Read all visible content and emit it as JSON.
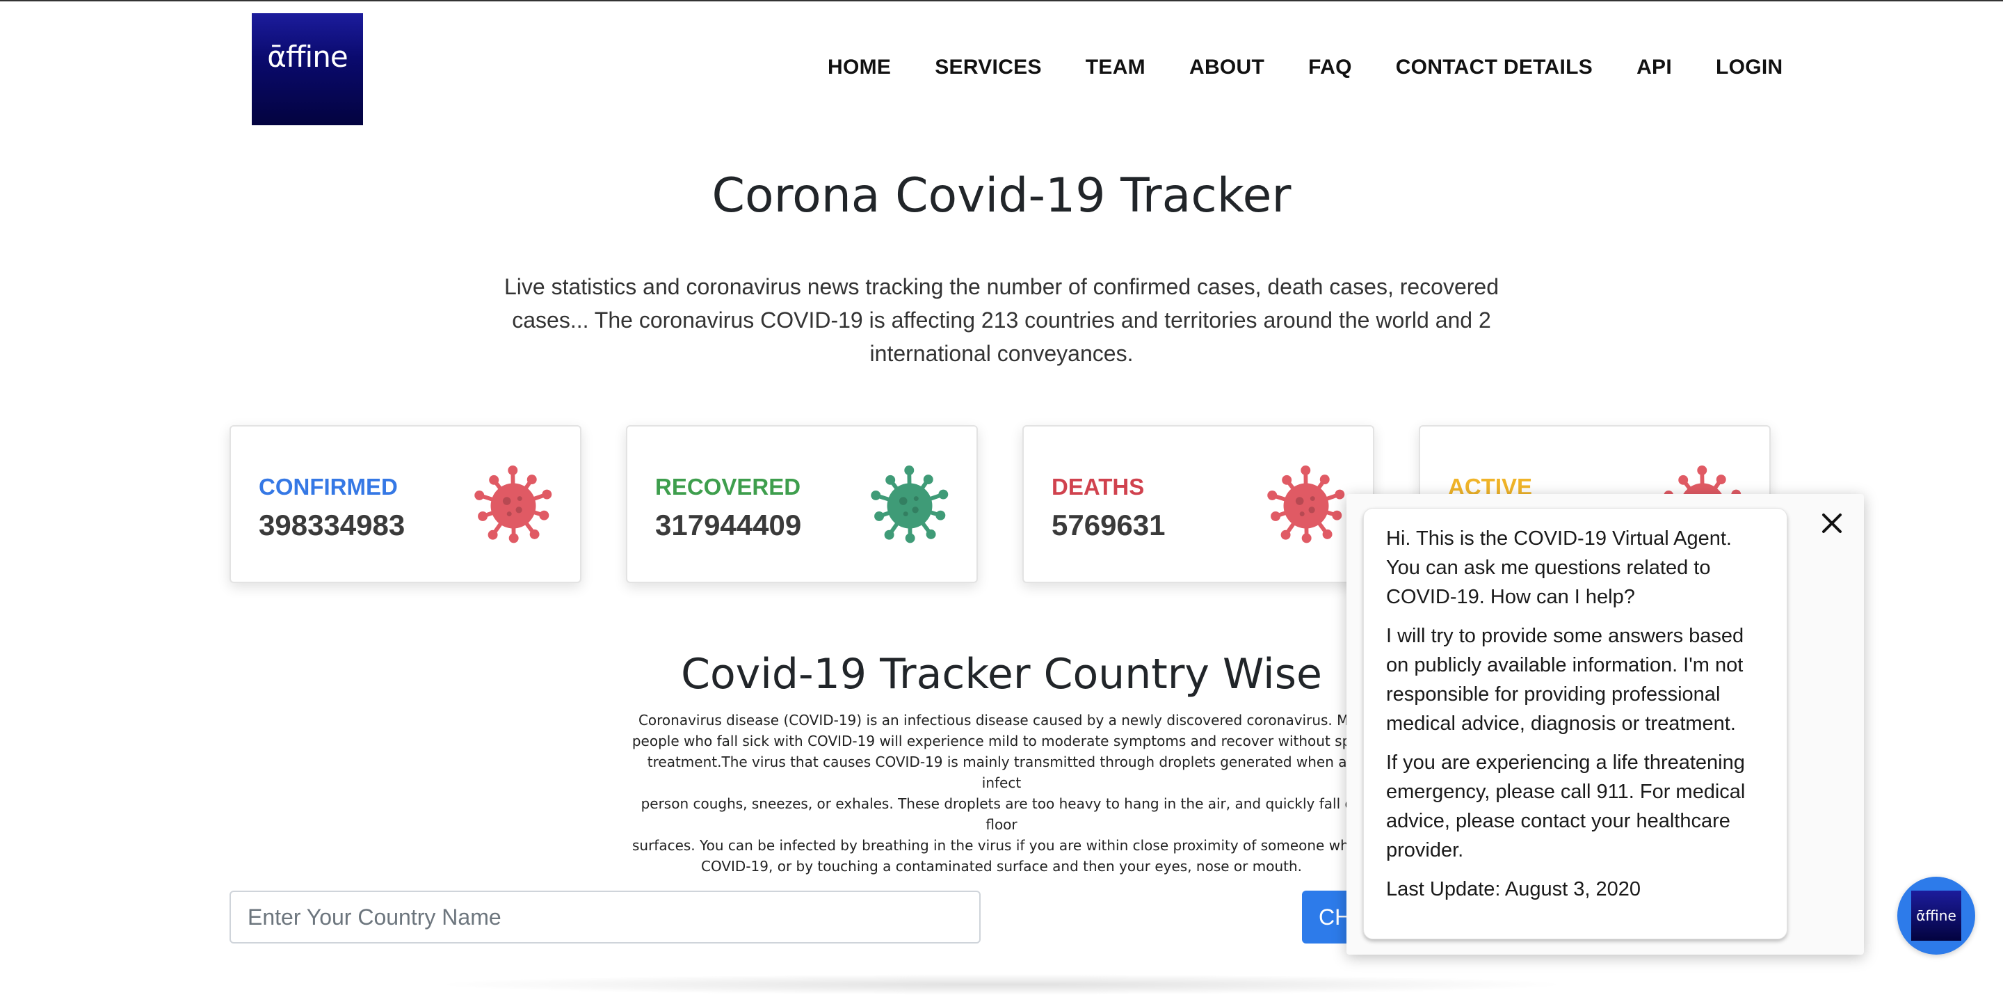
{
  "brand": {
    "logo_text": "ᾱffine"
  },
  "nav": {
    "items": [
      "HOME",
      "SERVICES",
      "TEAM",
      "ABOUT",
      "FAQ",
      "CONTACT DETAILS",
      "API",
      "LOGIN"
    ]
  },
  "hero": {
    "title": "Corona Covid-19 Tracker",
    "description": "Live statistics and coronavirus news tracking the number of confirmed cases, death cases, recovered cases... The coronavirus COVID-19 is affecting 213 countries and territories around the world and 2 international conveyances."
  },
  "stats": [
    {
      "label": "CONFIRMED",
      "value": "398334983",
      "label_color": "#3578e5",
      "icon": "virus-icon",
      "icon_color": "#e05a64"
    },
    {
      "label": "RECOVERED",
      "value": "317944409",
      "label_color": "#3e9e4d",
      "icon": "virus-icon",
      "icon_color": "#3f9b77"
    },
    {
      "label": "DEATHS",
      "value": "5769631",
      "label_color": "#d0424e",
      "icon": "virus-icon",
      "icon_color": "#e05a64"
    },
    {
      "label": "ACTIVE",
      "value": "",
      "label_color": "#f0b429",
      "icon": "virus-icon",
      "icon_color": "#e05a64"
    }
  ],
  "country_section": {
    "title": "Covid-19 Tracker Country Wise",
    "description_lines": [
      "Coronavirus disease (COVID-19) is an infectious disease caused by a newly discovered coronavirus. Mos",
      "people who fall sick with COVID-19 will experience mild to moderate symptoms and recover without speci",
      "treatment.The virus that causes COVID-19 is mainly transmitted through droplets generated when an infect",
      "person coughs, sneezes, or exhales. These droplets are too heavy to hang in the air, and quickly fall on floor",
      "surfaces. You can be infected by breathing in the virus if you are within close proximity of someone who h",
      "COVID-19, or by touching a contaminated surface and then your eyes, nose or mouth."
    ],
    "search_placeholder": "Enter Your Country Name",
    "check_button_label": "CH"
  },
  "chat": {
    "messages": [
      "Hi. This is the COVID-19 Virtual Agent. You can ask me questions related to COVID-19. How can I help?",
      "I will try to provide some answers based on publicly available information. I'm not responsible for providing professional medical advice, diagnosis or treatment.",
      "If you are experiencing a life threatening emergency, please call 911. For medical advice, please contact your healthcare provider.",
      "Last Update: August 3, 2020"
    ],
    "close_icon": "close-icon",
    "launcher_logo_text": "ᾱffine"
  }
}
